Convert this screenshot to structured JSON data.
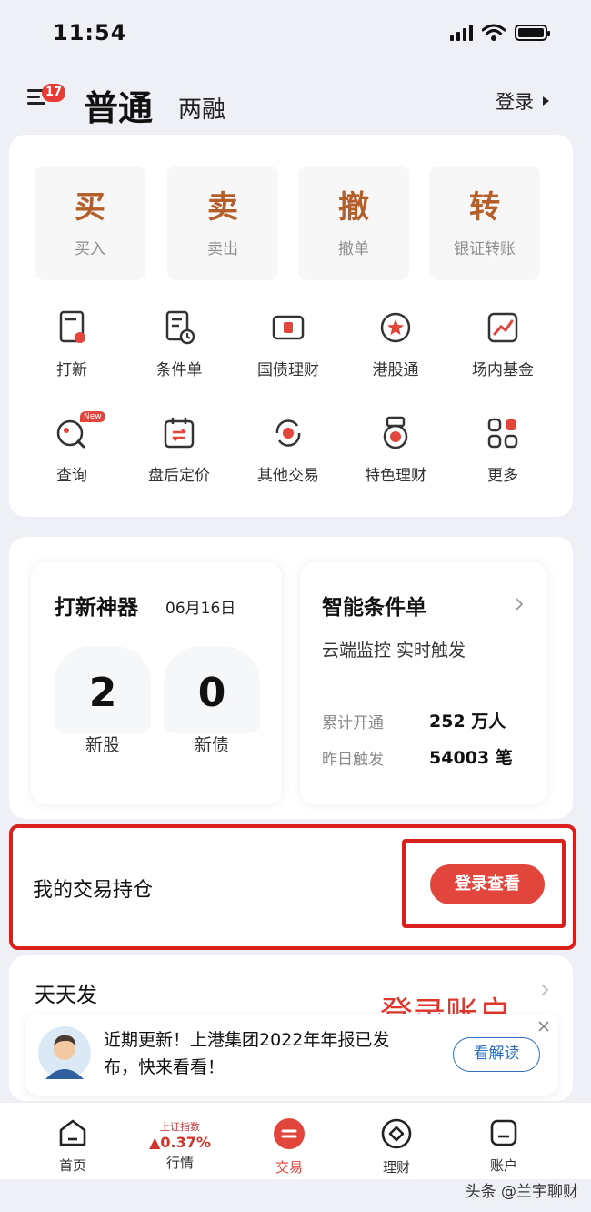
{
  "status_bar": {
    "time": "11:54"
  },
  "header": {
    "badge_count": "17",
    "tab_normal": "普通",
    "tab_margin": "两融",
    "login_label": "登录"
  },
  "quick_actions": [
    {
      "char": "买",
      "label": "买入"
    },
    {
      "char": "卖",
      "label": "卖出"
    },
    {
      "char": "撤",
      "label": "撤单"
    },
    {
      "char": "转",
      "label": "银证转账"
    }
  ],
  "functions_row1": [
    "打新",
    "条件单",
    "国债理财",
    "港股通",
    "场内基金"
  ],
  "functions_row2": [
    "查询",
    "盘后定价",
    "其他交易",
    "特色理财",
    "更多"
  ],
  "new_tag": "New",
  "ipo_tool": {
    "title": "打新神器",
    "date": "06月16日",
    "stock_count": "2",
    "stock_label": "新股",
    "bond_count": "0",
    "bond_label": "新债"
  },
  "smart_order": {
    "title": "智能条件单",
    "subtitle": "云端监控 实时触发",
    "stat1_label": "累计开通",
    "stat1_value": "252 万人",
    "stat2_label": "昨日触发",
    "stat2_value": "54003 笔"
  },
  "holdings": {
    "title": "我的交易持仓",
    "button": "登录查看"
  },
  "tiantian": {
    "title": "天天发",
    "overlay_annotation": "登录账户"
  },
  "notice": {
    "text": "近期更新！上港集团2022年年报已发布，快来看看！",
    "button": "看解读"
  },
  "tabbar": {
    "home": "首页",
    "index_name": "上证指数",
    "index_change": "▲0.37%",
    "market": "行情",
    "trade": "交易",
    "wealth": "理财",
    "account": "账户"
  },
  "watermark": "头条 @兰宇聊财",
  "colors": {
    "accent_red": "#e2453c",
    "highlight_border": "#d9201d",
    "brown_text": "#b45e2a"
  }
}
